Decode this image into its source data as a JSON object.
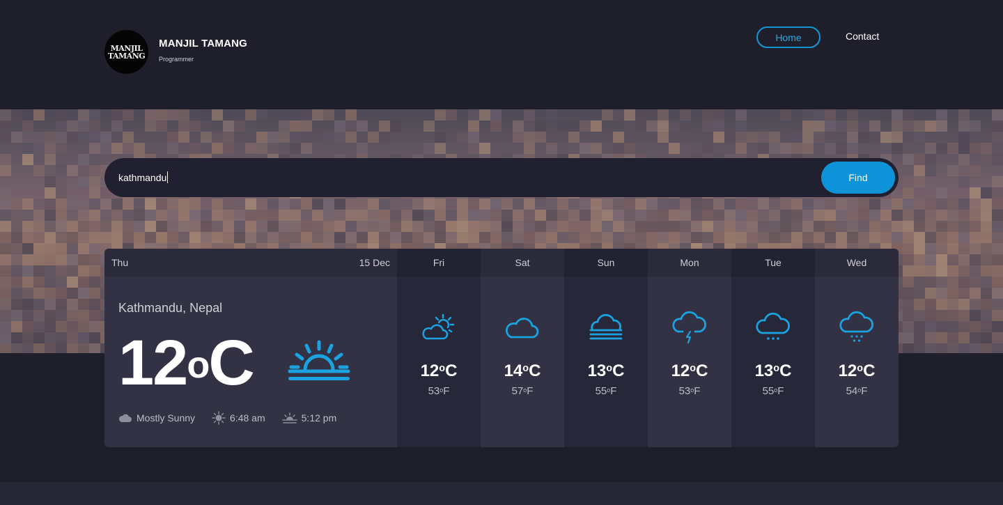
{
  "header": {
    "logo_lines": [
      "MANJIL",
      "TAMANG"
    ],
    "name": "MANJIL TAMANG",
    "role": "Programmer",
    "nav": {
      "home": "Home",
      "contact": "Contact"
    },
    "accent": "#0e93d8"
  },
  "search": {
    "value": "kathmandu",
    "button": "Find"
  },
  "today": {
    "day": "Thu",
    "date": "15 Dec",
    "location": "Kathmandu, Nepal",
    "temp": "12",
    "unit": "C",
    "icon": "sunrise-icon",
    "condition": "Mostly Sunny",
    "sunrise": "6:48 am",
    "sunset": "5:12 pm"
  },
  "forecast": [
    {
      "day": "Fri",
      "c": "12",
      "f": "53",
      "icon": "partly-sunny-icon"
    },
    {
      "day": "Sat",
      "c": "14",
      "f": "57",
      "icon": "cloud-icon"
    },
    {
      "day": "Sun",
      "c": "13",
      "f": "55",
      "icon": "fog-icon"
    },
    {
      "day": "Mon",
      "c": "12",
      "f": "53",
      "icon": "thunderstorm-icon"
    },
    {
      "day": "Tue",
      "c": "13",
      "f": "55",
      "icon": "drizzle-icon"
    },
    {
      "day": "Wed",
      "c": "12",
      "f": "54",
      "icon": "snow-icon"
    }
  ]
}
